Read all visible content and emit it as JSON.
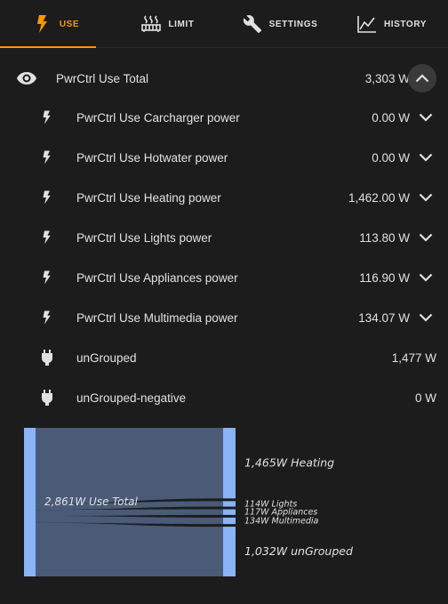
{
  "tabs": [
    {
      "label": "USE",
      "icon": "flash-icon",
      "active": true
    },
    {
      "label": "LIMIT",
      "icon": "radiator-icon",
      "active": false
    },
    {
      "label": "SETTINGS",
      "icon": "wrench-icon",
      "active": false
    },
    {
      "label": "HISTORY",
      "icon": "chart-line-icon",
      "active": false
    }
  ],
  "total": {
    "label": "PwrCtrl Use Total",
    "value": "3,303 W",
    "icon": "eye-icon"
  },
  "rows": [
    {
      "label": "PwrCtrl Use Carcharger power",
      "value": "0.00 W",
      "icon": "flash-icon"
    },
    {
      "label": "PwrCtrl Use Hotwater power",
      "value": "0.00 W",
      "icon": "flash-icon"
    },
    {
      "label": "PwrCtrl Use Heating power",
      "value": "1,462.00 W",
      "icon": "flash-icon"
    },
    {
      "label": "PwrCtrl Use Lights power",
      "value": "113.80 W",
      "icon": "flash-icon"
    },
    {
      "label": "PwrCtrl Use Appliances power",
      "value": "116.90 W",
      "icon": "flash-icon"
    },
    {
      "label": "PwrCtrl Use Multimedia power",
      "value": "134.07 W",
      "icon": "flash-icon"
    },
    {
      "label": "unGrouped",
      "value": "1,477 W",
      "icon": "power-plug-icon"
    },
    {
      "label": "unGrouped-negative",
      "value": "0 W",
      "icon": "power-plug-icon"
    }
  ],
  "colors": {
    "accent": "#ff9800",
    "node": "#8ab4f8",
    "flow": "#4a5b78",
    "background": "#1c1c1c"
  },
  "chart_data": {
    "type": "sankey",
    "source": {
      "label": "2,861W Use Total",
      "value": 2861
    },
    "targets": [
      {
        "label": "1,465W Heating",
        "value": 1465
      },
      {
        "label": "114W Lights",
        "value": 114
      },
      {
        "label": "117W Appliances",
        "value": 117
      },
      {
        "label": "134W Multimedia",
        "value": 134
      },
      {
        "label": "1,032W unGrouped",
        "value": 1032
      }
    ]
  }
}
